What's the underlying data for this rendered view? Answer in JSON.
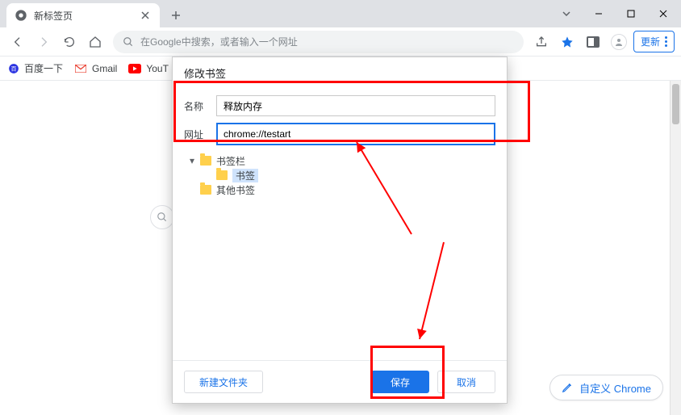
{
  "tab": {
    "title": "新标签页"
  },
  "omnibox": {
    "placeholder": "在Google中搜索，或者输入一个网址"
  },
  "update_button": "更新",
  "bookmarks_bar": {
    "items": [
      {
        "label": "百度一下"
      },
      {
        "label": "Gmail"
      },
      {
        "label": "YouT"
      }
    ]
  },
  "dialog": {
    "title": "修改书签",
    "name_label": "名称",
    "name_value": "释放内存",
    "url_label": "网址",
    "url_value": "chrome://testart",
    "tree": {
      "root": "书签栏",
      "selected": "书签",
      "other": "其他书签"
    },
    "new_folder": "新建文件夹",
    "save": "保存",
    "cancel": "取消"
  },
  "customize": "自定义 Chrome"
}
